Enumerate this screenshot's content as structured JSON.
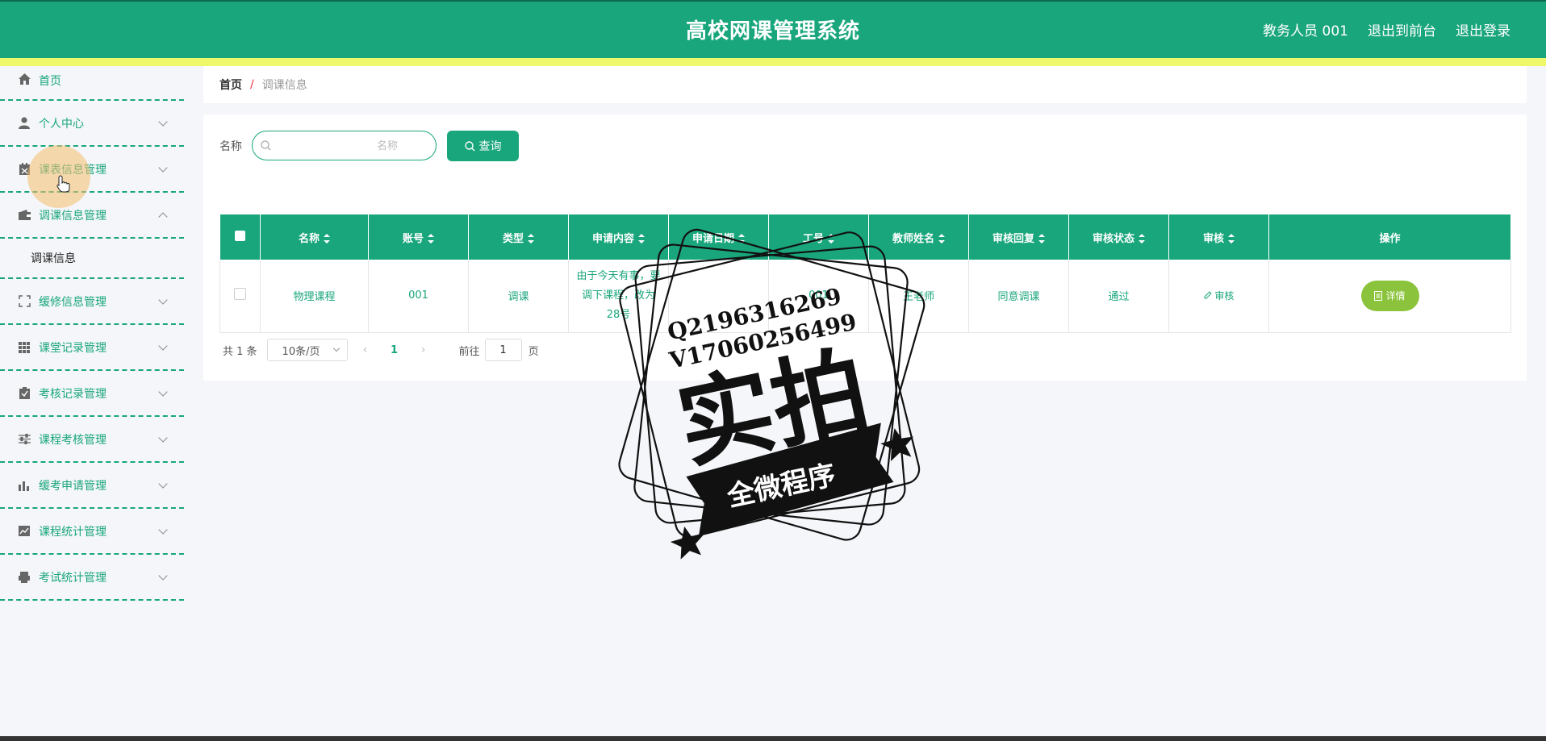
{
  "header": {
    "title": "高校网课管理系统",
    "user": "教务人员 001",
    "to_front": "退出到前台",
    "logout": "退出登录"
  },
  "sidebar": {
    "items": [
      {
        "label": "首页",
        "icon": "home-icon"
      },
      {
        "label": "个人中心",
        "icon": "user-icon"
      },
      {
        "label": "课表信息管理",
        "icon": "calendar-icon"
      },
      {
        "label": "调课信息管理",
        "icon": "wallet-icon",
        "expanded": true,
        "children": [
          "调课信息"
        ]
      },
      {
        "label": "缓修信息管理",
        "icon": "fullscreen-icon"
      },
      {
        "label": "课堂记录管理",
        "icon": "grid-icon"
      },
      {
        "label": "考核记录管理",
        "icon": "clipboard-check-icon"
      },
      {
        "label": "课程考核管理",
        "icon": "sliders-icon"
      },
      {
        "label": "缓考申请管理",
        "icon": "bar-chart-icon"
      },
      {
        "label": "课程统计管理",
        "icon": "trend-chart-icon"
      },
      {
        "label": "考试统计管理",
        "icon": "printer-icon"
      }
    ]
  },
  "breadcrumb": {
    "home": "首页",
    "sep": "/",
    "current": "调课信息"
  },
  "search": {
    "label": "名称",
    "placeholder": "名称",
    "button": "查询"
  },
  "table": {
    "headers": [
      "名称",
      "账号",
      "类型",
      "申请内容",
      "申请日期",
      "工号",
      "教师姓名",
      "审核回复",
      "审核状态",
      "审核",
      "操作"
    ],
    "rows": [
      {
        "name": "物理课程",
        "account": "001",
        "type": "调课",
        "content": "由于今天有事，要调下课程，改为28号",
        "date": "",
        "job_no": "001",
        "teacher": "王老师",
        "reply": "同意调课",
        "status": "通过",
        "audit": "审核",
        "action": "详情"
      }
    ]
  },
  "pager": {
    "total": "共 1 条",
    "page_size": "10条/页",
    "current": "1",
    "goto_label": "前往",
    "goto_value": "1",
    "page_word": "页"
  },
  "watermark": {
    "qq": "Q2196316269",
    "vx": "V17060256499",
    "big": "实拍",
    "banner": "全微程序"
  },
  "colors": {
    "primary": "#1aa67c",
    "stripe": "#eef86a",
    "detail_button": "#8bc43c"
  }
}
